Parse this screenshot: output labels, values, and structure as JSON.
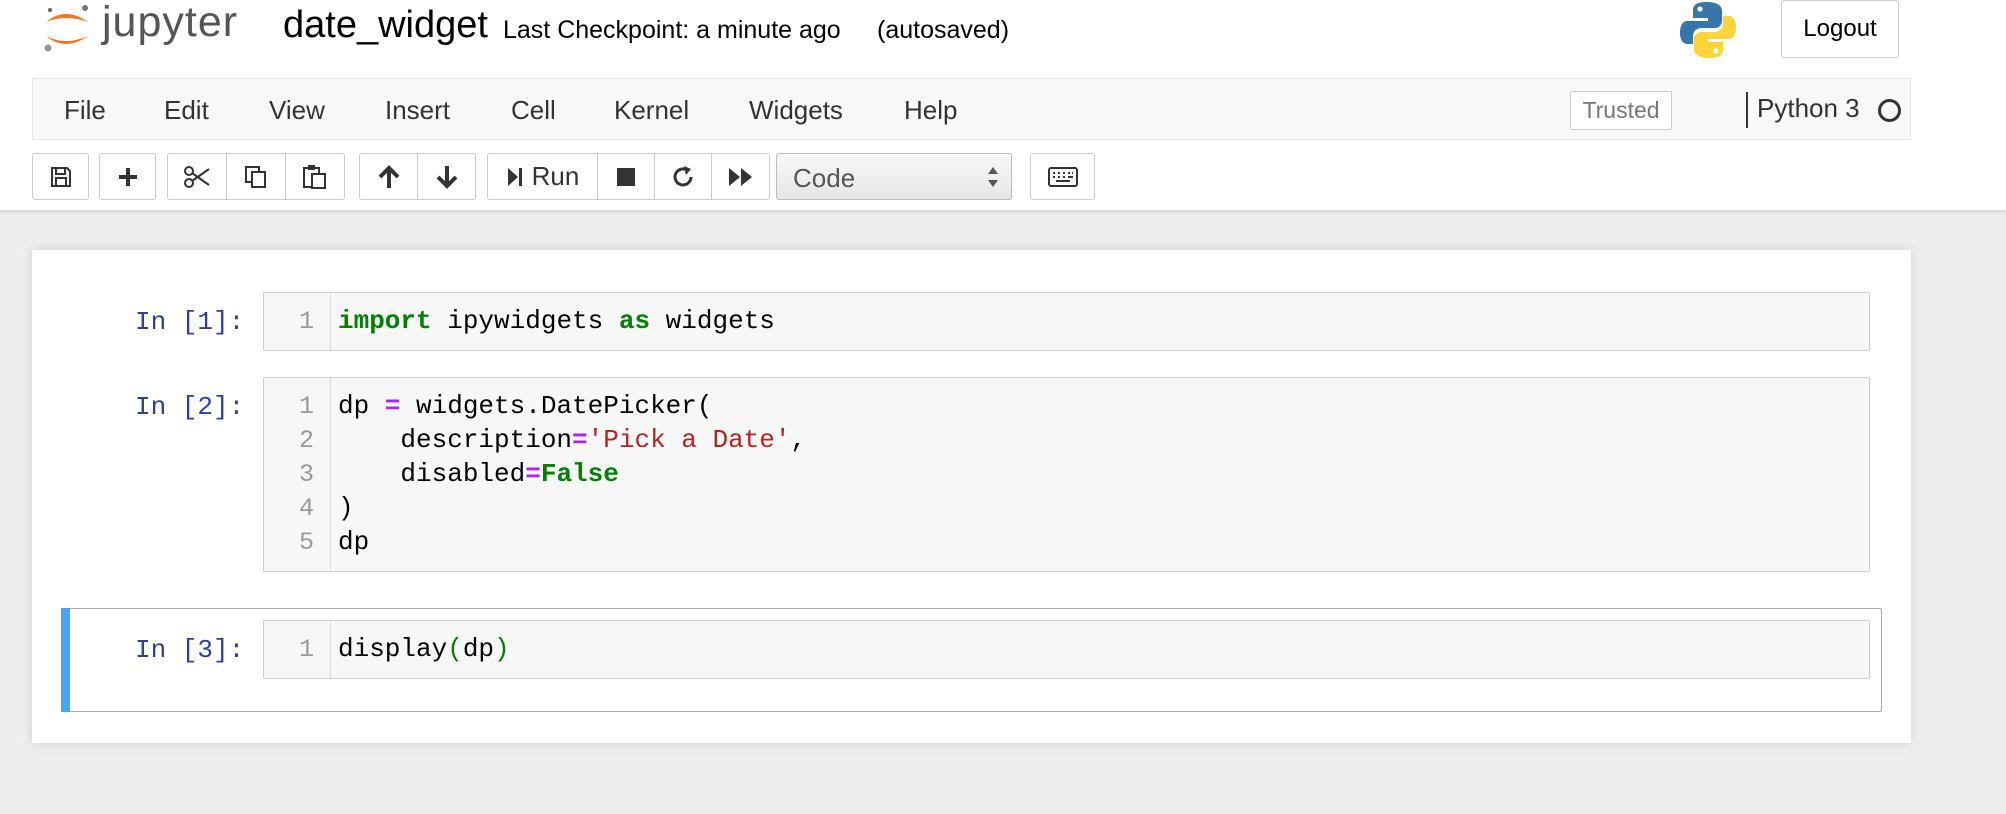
{
  "header": {
    "logo_text": "jupyter",
    "notebook_name": "date_widget",
    "checkpoint": "Last Checkpoint: a minute ago",
    "autosave_status": "(autosaved)",
    "logout_label": "Logout"
  },
  "menubar": {
    "items": [
      "File",
      "Edit",
      "View",
      "Insert",
      "Cell",
      "Kernel",
      "Widgets",
      "Help"
    ],
    "trusted_label": "Trusted",
    "kernel_name": "Python 3"
  },
  "toolbar": {
    "run_label": "Run",
    "cell_type": "Code",
    "icons": [
      "save-icon",
      "plus-icon",
      "scissors-icon",
      "copy-icon",
      "paste-icon",
      "arrow-up-icon",
      "arrow-down-icon",
      "step-forward-icon",
      "stop-icon",
      "restart-icon",
      "fast-forward-icon",
      "keyboard-icon"
    ]
  },
  "cells": [
    {
      "prompt": "In [1]:",
      "line_numbers": [
        "1"
      ],
      "lines": [
        [
          {
            "t": "import",
            "c": "kw"
          },
          {
            "t": " ipywidgets ",
            "c": ""
          },
          {
            "t": "as",
            "c": "kw"
          },
          {
            "t": " widgets",
            "c": ""
          }
        ]
      ]
    },
    {
      "prompt": "In [2]:",
      "line_numbers": [
        "1",
        "2",
        "3",
        "4",
        "5"
      ],
      "lines": [
        [
          {
            "t": "dp ",
            "c": ""
          },
          {
            "t": "=",
            "c": "op"
          },
          {
            "t": " widgets.DatePicker(",
            "c": ""
          }
        ],
        [
          {
            "t": "    description",
            "c": ""
          },
          {
            "t": "=",
            "c": "op"
          },
          {
            "t": "'Pick a Date'",
            "c": "str"
          },
          {
            "t": ",",
            "c": ""
          }
        ],
        [
          {
            "t": "    disabled",
            "c": ""
          },
          {
            "t": "=",
            "c": "op"
          },
          {
            "t": "False",
            "c": "kw"
          }
        ],
        [
          {
            "t": ")",
            "c": ""
          }
        ],
        [
          {
            "t": "dp",
            "c": ""
          }
        ]
      ]
    },
    {
      "prompt": "In [3]:",
      "line_numbers": [
        "1"
      ],
      "lines": [
        [
          {
            "t": "display",
            "c": ""
          },
          {
            "t": "(",
            "c": "par"
          },
          {
            "t": "dp",
            "c": ""
          },
          {
            "t": ")",
            "c": "par"
          }
        ]
      ]
    }
  ]
}
